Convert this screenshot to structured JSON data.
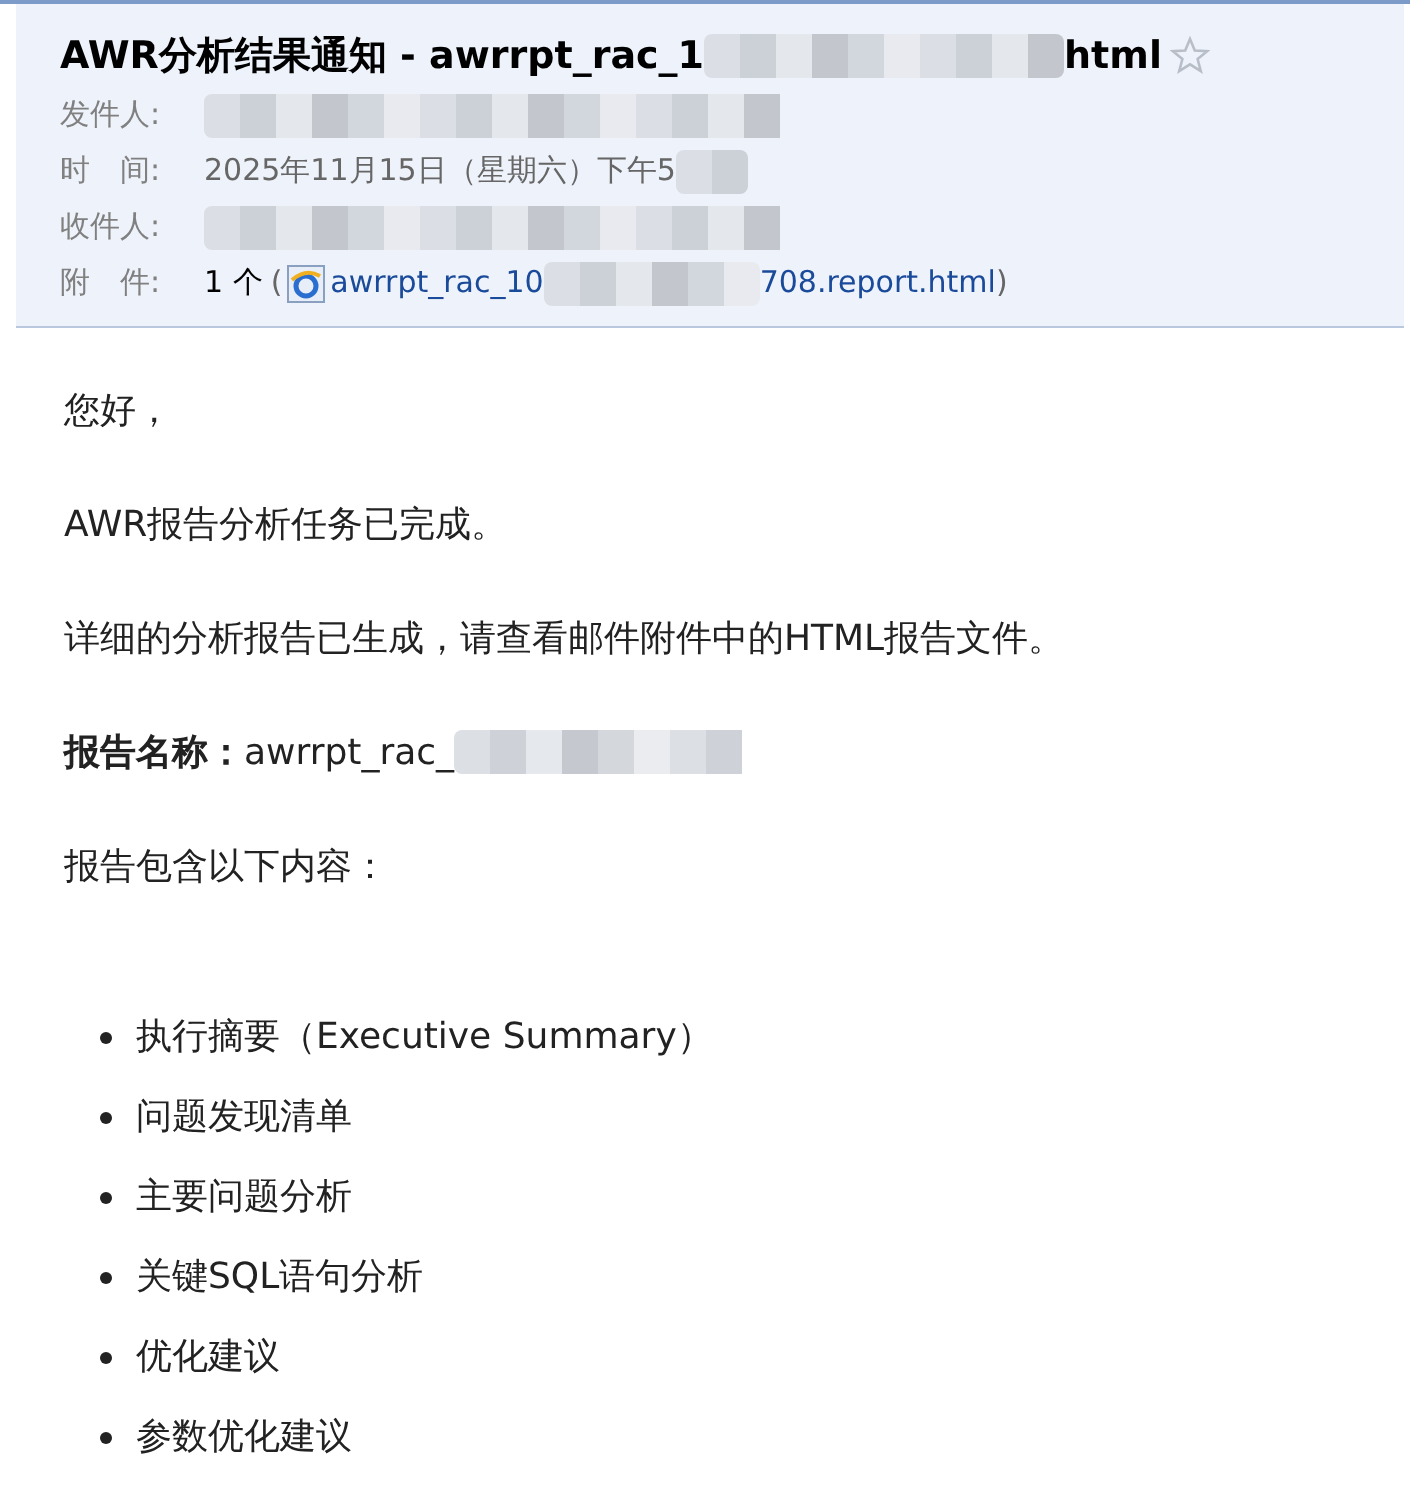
{
  "header": {
    "subject_start": "AWR分析结果通知 - awrrpt_rac_1",
    "subject_end": "html",
    "starred": false,
    "fields": [
      {
        "kind": "redacted",
        "label": "发件人:"
      },
      {
        "kind": "text",
        "label": "时　间:",
        "value": "2025年11月15日（星期六）下午5"
      },
      {
        "kind": "redacted",
        "label": "收件人:"
      },
      {
        "kind": "attachment",
        "label": "附　件:",
        "count": "1 个",
        "open": "(",
        "file_start": "awrrpt_rac_10",
        "file_end": "708.report.html",
        "close": ")"
      }
    ]
  },
  "body": {
    "greeting": "您好，",
    "lines": [
      "AWR报告分析任务已完成。",
      "详细的分析报告已生成，请查看邮件附件中的HTML报告文件。"
    ],
    "report_name_label": "报告名称：",
    "report_name_value": "awrrpt_rac_",
    "contents_intro": "报告包含以下内容：",
    "bullets": [
      "执行摘要（Executive Summary）",
      "问题发现清单",
      "主要问题分析",
      "关键SQL语句分析",
      "优化建议",
      "参数优化建议"
    ]
  }
}
